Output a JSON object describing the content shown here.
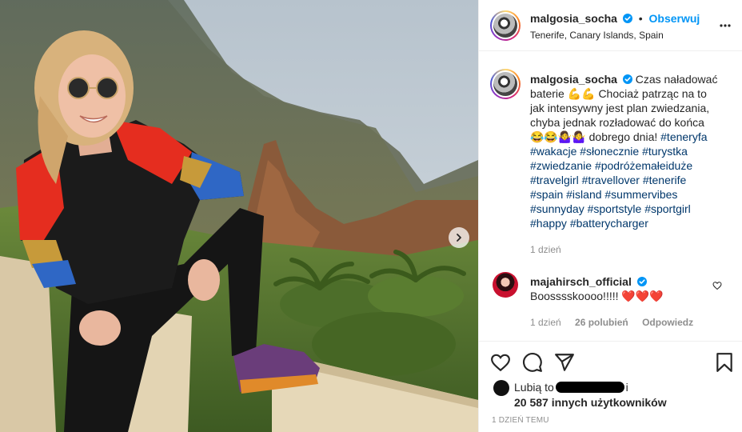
{
  "post": {
    "author": "malgosia_socha",
    "follow_label": "Obserwuj",
    "separator": "•",
    "location": "Tenerife, Canary Islands, Spain"
  },
  "caption": {
    "author": "malgosia_socha",
    "text_lines": [
      "Czas naładować",
      "baterie 💪💪 Chociaż patrząc na to",
      "jak intensywny jest plan zwiedzania,",
      "chyba jednak rozładować do końca",
      "😂😂🤷‍♀️🤷‍♀️ dobrego dnia!"
    ],
    "hashtags": [
      "#teneryfa",
      "#wakacje #słonecznie #turystka",
      "#zwiedzanie #podróżemałeiduże",
      "#travelgirl #travellover #tenerife",
      "#spain #island #summervibes",
      "#sunnyday #sportstyle #sportgirl",
      "#happy #batterycharger"
    ],
    "age": "1 dzień"
  },
  "comment": {
    "author": "majahirsch_official",
    "text": "Boosssskoooo!!!!! ❤️❤️❤️",
    "age": "1 dzień",
    "likes": "26 polubień",
    "reply_label": "Odpowiedz"
  },
  "likes": {
    "prefix": "Lubią to",
    "suffix": "i",
    "count_text": "20 587 innych użytkowników"
  },
  "time_ago": "1 DZIEŃ TEMU",
  "colors": {
    "link": "#0095f6",
    "hashtag": "#00376b",
    "muted": "#8e8e8e",
    "heart": "#ed4956"
  },
  "icons": [
    "chevron-right-icon",
    "verified-badge-icon",
    "more-options-icon",
    "heart-icon",
    "comment-icon",
    "share-icon",
    "bookmark-icon"
  ]
}
